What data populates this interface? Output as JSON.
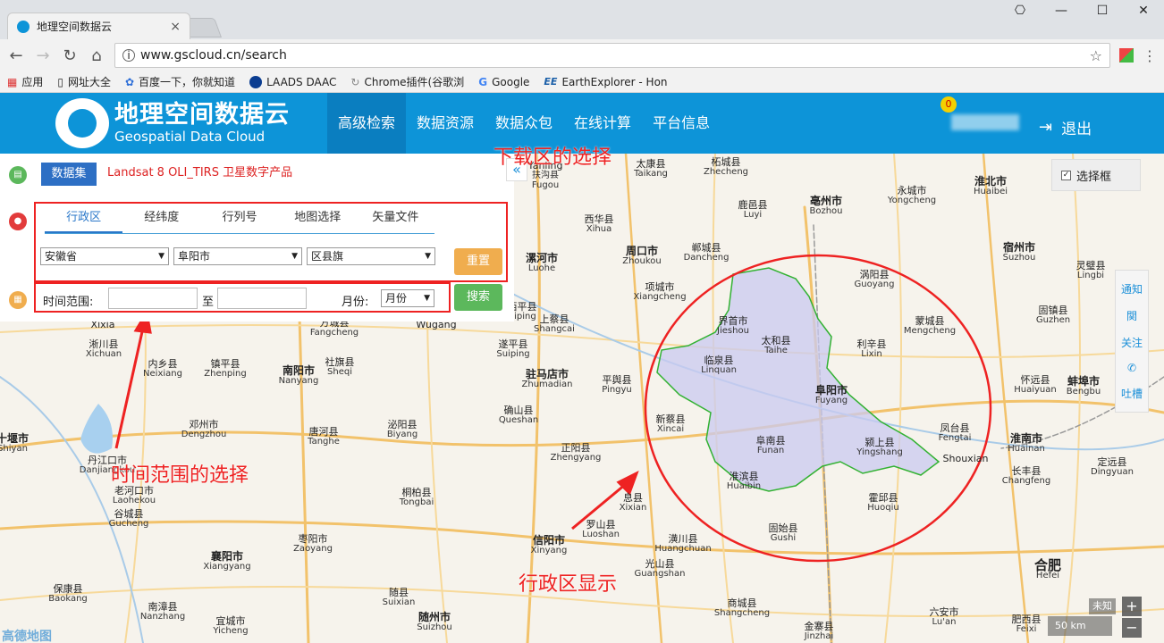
{
  "browser": {
    "tab_title": "地理空间数据云",
    "url": "www.gscloud.cn/search",
    "window_controls": [
      "minimize-icon",
      "maximize-icon",
      "close-icon"
    ],
    "bookmarks": [
      {
        "label": "应用",
        "icon": "apps-grid-icon"
      },
      {
        "label": "网址大全",
        "icon": "page-icon"
      },
      {
        "label": "百度一下，你就知道",
        "icon": "baidu-paw-icon"
      },
      {
        "label": "LAADS DAAC",
        "icon": "nasa-icon"
      },
      {
        "label": "Chrome插件(谷歌浏",
        "icon": "plugin-icon"
      },
      {
        "label": "Google",
        "icon": "google-icon"
      },
      {
        "label": "EarthExplorer - Hon",
        "icon": "ee-icon"
      }
    ]
  },
  "site": {
    "logo_cn": "地理空间数据云",
    "logo_en": "Geospatial Data Cloud",
    "nav": [
      "高级检索",
      "数据资源",
      "数据众包",
      "在线计算",
      "平台信息"
    ],
    "active_nav": "高级检索",
    "notification_count": "0",
    "logout": "退出",
    "brand_color": "#0d94d8"
  },
  "panel": {
    "dataset_button": "数据集",
    "dataset_name": "Landsat 8 OLI_TIRS 卫星数字产品",
    "tabs": [
      "行政区",
      "经纬度",
      "行列号",
      "地图选择",
      "矢量文件"
    ],
    "active_tab": "行政区",
    "province": "安徽省",
    "city": "阜阳市",
    "county": "区县旗",
    "reset": "重置",
    "time_label": "时间范围:",
    "to_label": "至",
    "month_label": "月份:",
    "month_value": "月份",
    "search": "搜索",
    "start_value": "",
    "end_value": ""
  },
  "map": {
    "select_box": "选择框",
    "side_tools": [
      "通知",
      "関",
      "关注",
      "吐槽"
    ],
    "zoom_in": "+",
    "zoom_out": "−",
    "scale": "50 km",
    "unknown_label": "未知",
    "provider": "高德地图",
    "cities": [
      {
        "cn": "泌阳县",
        "en": "Biyang"
      }
    ]
  },
  "annotations": {
    "download_area": "下载区的选择",
    "time_range": "时间范围的选择",
    "admin_display": "行政区显示"
  }
}
